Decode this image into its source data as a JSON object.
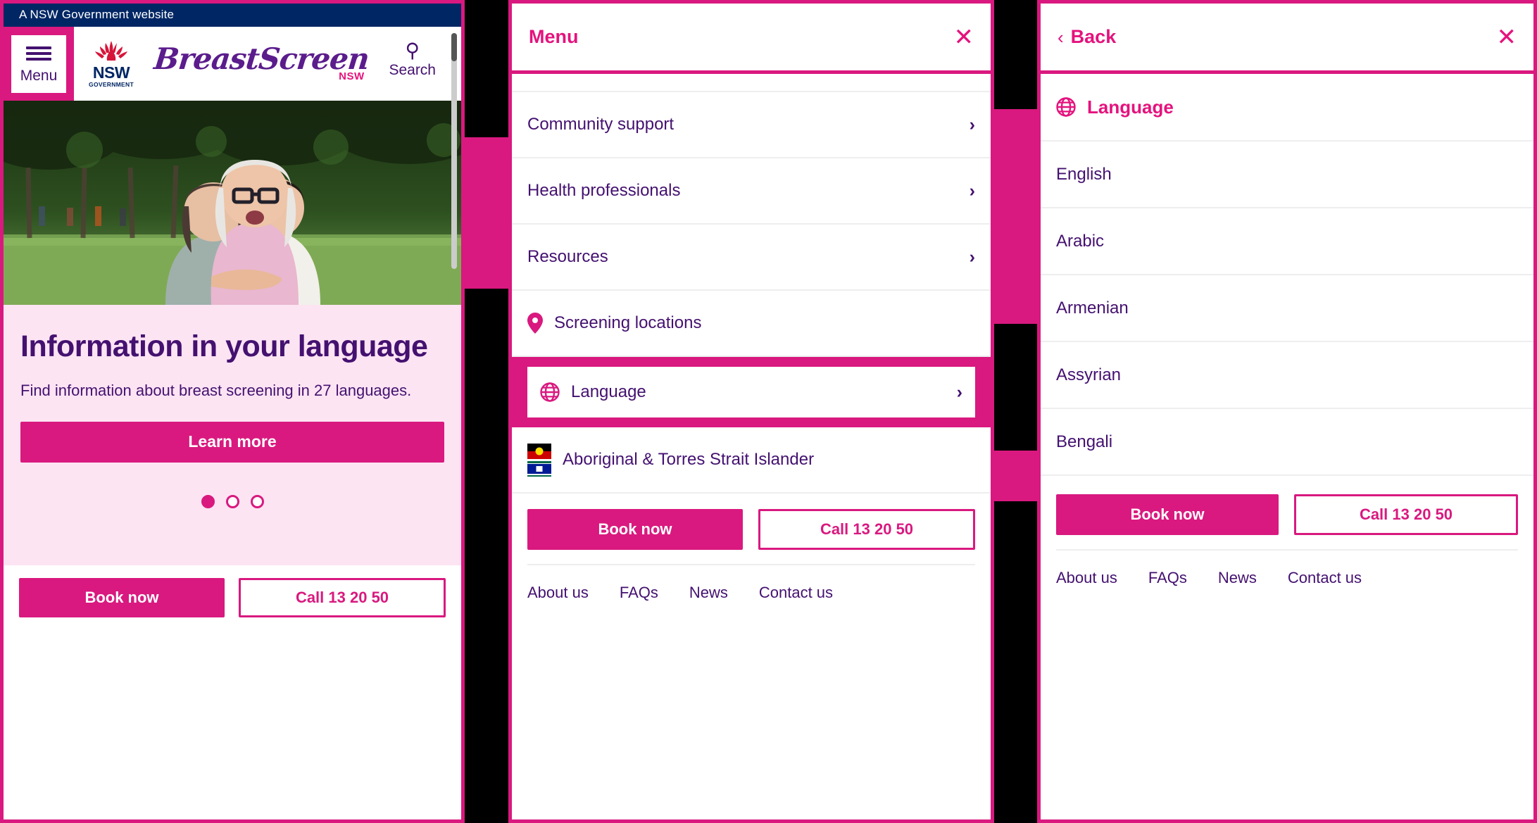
{
  "theme": {
    "pink": "#d9197f",
    "magenta": "#e5127d",
    "purple": "#441170",
    "nsw_navy": "#002664",
    "pale_pink": "#fde4f3"
  },
  "home": {
    "gov_bar": "A NSW Government website",
    "menu_button": "Menu",
    "nsw_logo_word": "NSW",
    "nsw_logo_sub": "GOVERNMENT",
    "brand_script": "BreastScreen",
    "brand_state": "NSW",
    "search_label": "Search",
    "hero_title": "Information in your language",
    "hero_sub": "Find information about breast screening in 27 languages.",
    "learn_more": "Learn more",
    "carousel": {
      "total": 3,
      "active": 1
    },
    "cta": {
      "book": "Book now",
      "call": "Call 13 20 50"
    }
  },
  "menu_drawer": {
    "title": "Menu",
    "close_label": "✕",
    "items": [
      {
        "label": "Community support",
        "chevron": "›",
        "icon": null
      },
      {
        "label": "Health professionals",
        "chevron": "›",
        "icon": null
      },
      {
        "label": "Resources",
        "chevron": "›",
        "icon": null
      },
      {
        "label": "Screening locations",
        "chevron": "",
        "icon": "location-pin-icon"
      }
    ],
    "highlighted": {
      "label": "Language",
      "chevron": "›",
      "icon": "globe-icon"
    },
    "aboriginal": {
      "label": "Aboriginal & Torres Strait Islander",
      "icon": "aboriginal-torres-strait-flags-icon"
    },
    "cta": {
      "book": "Book now",
      "call": "Call 13 20 50"
    },
    "footer_links": [
      "About us",
      "FAQs",
      "News",
      "Contact us"
    ]
  },
  "language_drawer": {
    "back_label": "Back",
    "back_chevron": "‹",
    "close_label": "✕",
    "heading": "Language",
    "heading_icon": "globe-icon",
    "languages": [
      "English",
      "Arabic",
      "Armenian",
      "Assyrian",
      "Bengali"
    ],
    "cta": {
      "book": "Book now",
      "call": "Call 13 20 50"
    },
    "footer_links": [
      "About us",
      "FAQs",
      "News",
      "Contact us"
    ]
  }
}
